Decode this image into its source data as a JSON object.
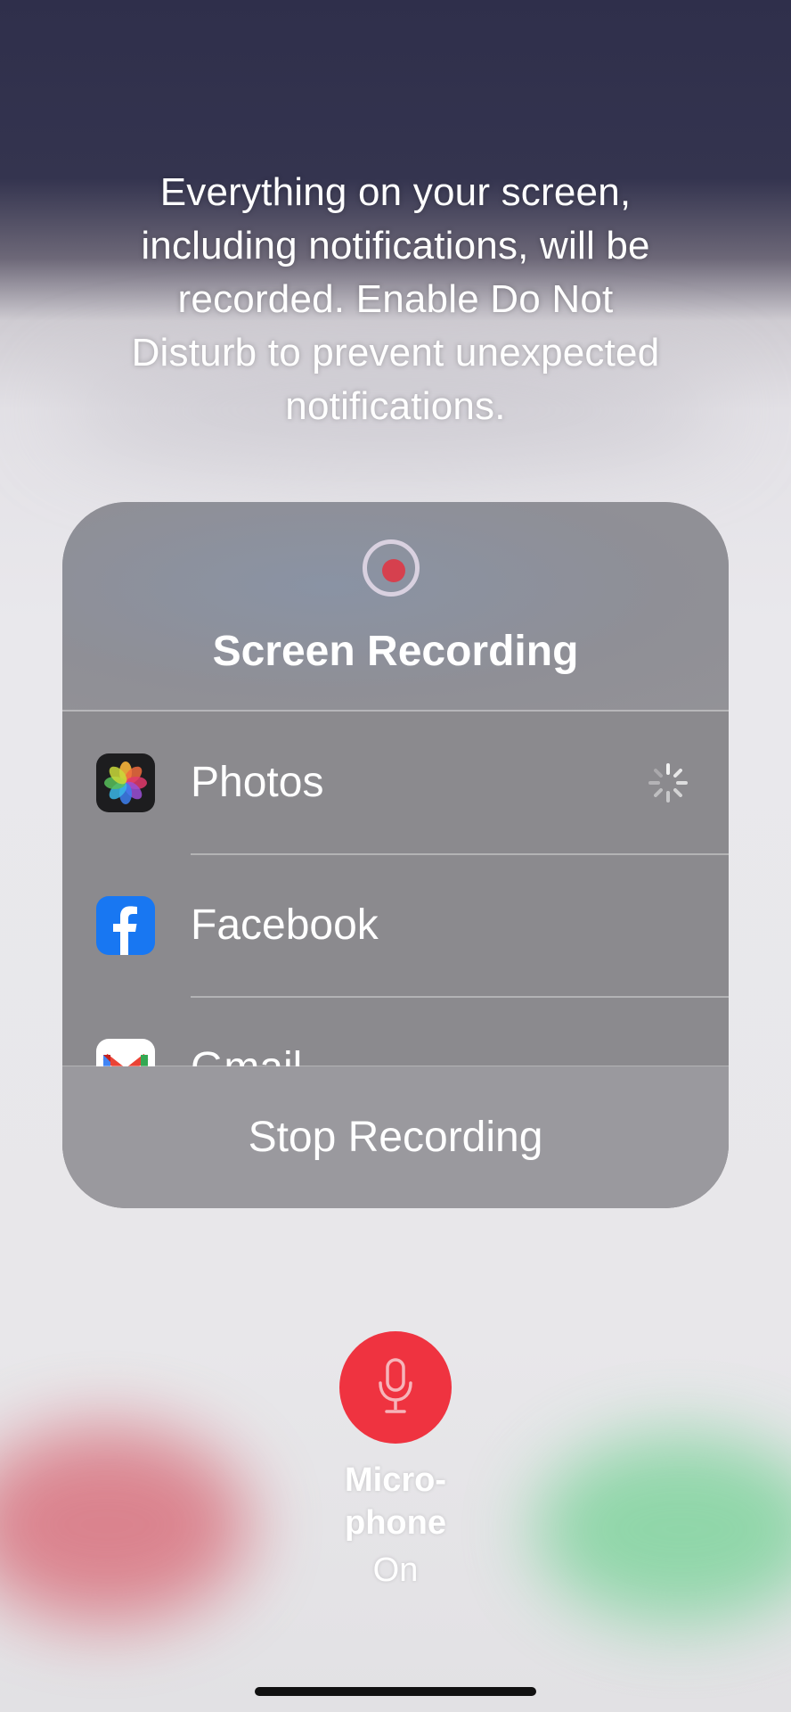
{
  "notice": {
    "line1": "Everything on your screen,",
    "line2": "including notifications, will be",
    "line3": "recorded. Enable Do Not",
    "line4": "Disturb to prevent unexpected",
    "line5": "notifications."
  },
  "panel": {
    "title": "Screen Recording",
    "apps": [
      {
        "label": "Photos",
        "icon": "photos-icon",
        "state": "loading"
      },
      {
        "label": "Facebook",
        "icon": "facebook-icon"
      },
      {
        "label": "Gmail",
        "icon": "gmail-icon"
      }
    ],
    "stop_label": "Stop Recording",
    "record_color": "#d6404e"
  },
  "microphone": {
    "label_line1": "Micro-",
    "label_line2": "phone",
    "state": "On",
    "button_color": "#ef3340",
    "icon": "microphone-icon"
  }
}
